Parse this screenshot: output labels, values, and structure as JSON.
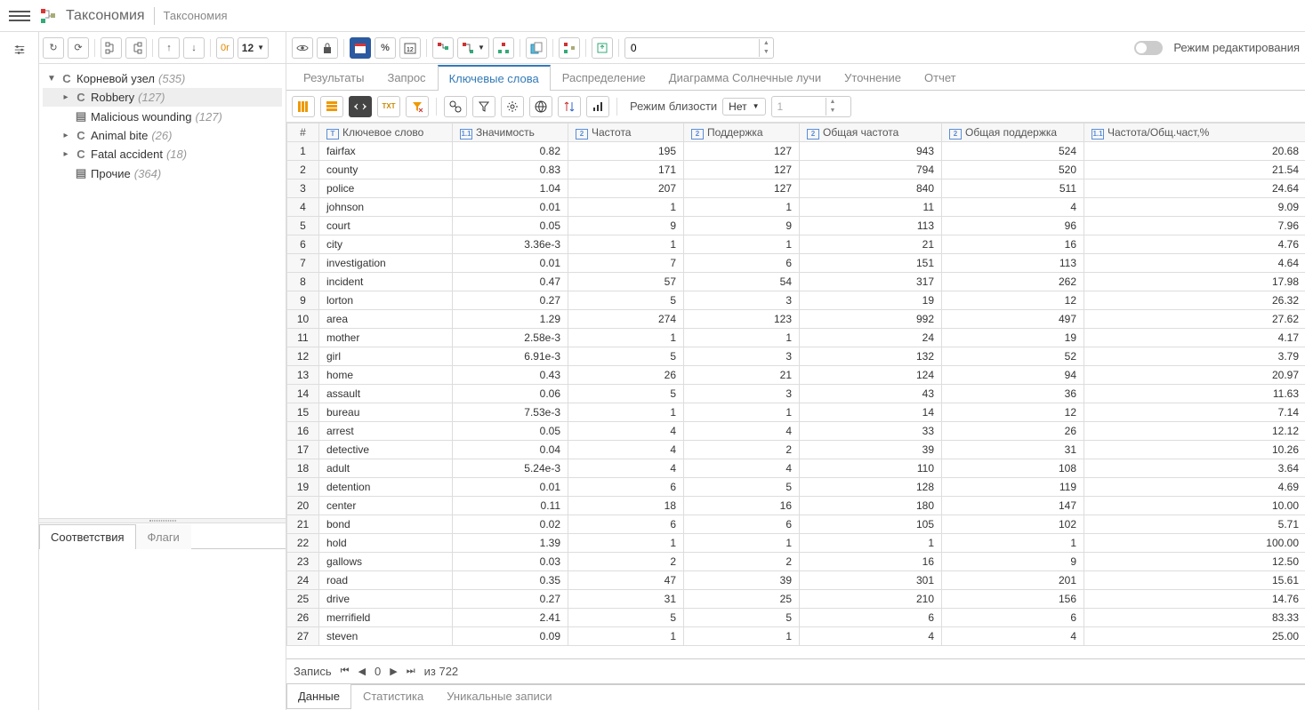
{
  "header": {
    "title": "Таксономия",
    "subtitle": "Таксономия"
  },
  "sidebarToolbar": {
    "or_label": "0r",
    "font_size": "12"
  },
  "tree": {
    "root": {
      "label": "Корневой узел",
      "count": "(535)",
      "type": "C"
    },
    "children": [
      {
        "label": "Robbery",
        "count": "(127)",
        "type": "C",
        "selected": true,
        "expandable": true
      },
      {
        "label": "Malicious wounding",
        "count": "(127)",
        "type": "D",
        "expandable": false
      },
      {
        "label": "Animal bite",
        "count": "(26)",
        "type": "C",
        "expandable": true
      },
      {
        "label": "Fatal accident",
        "count": "(18)",
        "type": "C",
        "expandable": true
      },
      {
        "label": "Прочие",
        "count": "(364)",
        "type": "D",
        "expandable": false
      }
    ]
  },
  "bottomPanelTabs": [
    {
      "label": "Соответствия",
      "active": true
    },
    {
      "label": "Флаги",
      "active": false
    }
  ],
  "mainToolbar": {
    "num_input_value": "0",
    "edit_mode_label": "Режим редактирования"
  },
  "mainTabs": [
    {
      "label": "Результаты",
      "active": false
    },
    {
      "label": "Запрос",
      "active": false
    },
    {
      "label": "Ключевые слова",
      "active": true
    },
    {
      "label": "Распределение",
      "active": false
    },
    {
      "label": "Диаграмма Солнечные лучи",
      "active": false
    },
    {
      "label": "Уточнение",
      "active": false
    },
    {
      "label": "Отчет",
      "active": false
    }
  ],
  "filterBar": {
    "proximity_label": "Режим близости",
    "proximity_value": "Нет",
    "spinner_value": "1"
  },
  "table": {
    "columns": [
      {
        "label": "#",
        "icon": ""
      },
      {
        "label": "Ключевое слово",
        "icon": "T"
      },
      {
        "label": "Значимость",
        "icon": "1.1"
      },
      {
        "label": "Частота",
        "icon": "2"
      },
      {
        "label": "Поддержка",
        "icon": "2"
      },
      {
        "label": "Общая частота",
        "icon": "2"
      },
      {
        "label": "Общая поддержка",
        "icon": "2"
      },
      {
        "label": "Частота/Общ.част,%",
        "icon": "1.1"
      }
    ],
    "rows": [
      [
        "1",
        "fairfax",
        "0.82",
        "195",
        "127",
        "943",
        "524",
        "20.68"
      ],
      [
        "2",
        "county",
        "0.83",
        "171",
        "127",
        "794",
        "520",
        "21.54"
      ],
      [
        "3",
        "police",
        "1.04",
        "207",
        "127",
        "840",
        "511",
        "24.64"
      ],
      [
        "4",
        "johnson",
        "0.01",
        "1",
        "1",
        "11",
        "4",
        "9.09"
      ],
      [
        "5",
        "court",
        "0.05",
        "9",
        "9",
        "113",
        "96",
        "7.96"
      ],
      [
        "6",
        "city",
        "3.36e-3",
        "1",
        "1",
        "21",
        "16",
        "4.76"
      ],
      [
        "7",
        "investigation",
        "0.01",
        "7",
        "6",
        "151",
        "113",
        "4.64"
      ],
      [
        "8",
        "incident",
        "0.47",
        "57",
        "54",
        "317",
        "262",
        "17.98"
      ],
      [
        "9",
        "lorton",
        "0.27",
        "5",
        "3",
        "19",
        "12",
        "26.32"
      ],
      [
        "10",
        "area",
        "1.29",
        "274",
        "123",
        "992",
        "497",
        "27.62"
      ],
      [
        "11",
        "mother",
        "2.58e-3",
        "1",
        "1",
        "24",
        "19",
        "4.17"
      ],
      [
        "12",
        "girl",
        "6.91e-3",
        "5",
        "3",
        "132",
        "52",
        "3.79"
      ],
      [
        "13",
        "home",
        "0.43",
        "26",
        "21",
        "124",
        "94",
        "20.97"
      ],
      [
        "14",
        "assault",
        "0.06",
        "5",
        "3",
        "43",
        "36",
        "11.63"
      ],
      [
        "15",
        "bureau",
        "7.53e-3",
        "1",
        "1",
        "14",
        "12",
        "7.14"
      ],
      [
        "16",
        "arrest",
        "0.05",
        "4",
        "4",
        "33",
        "26",
        "12.12"
      ],
      [
        "17",
        "detective",
        "0.04",
        "4",
        "2",
        "39",
        "31",
        "10.26"
      ],
      [
        "18",
        "adult",
        "5.24e-3",
        "4",
        "4",
        "110",
        "108",
        "3.64"
      ],
      [
        "19",
        "detention",
        "0.01",
        "6",
        "5",
        "128",
        "119",
        "4.69"
      ],
      [
        "20",
        "center",
        "0.11",
        "18",
        "16",
        "180",
        "147",
        "10.00"
      ],
      [
        "21",
        "bond",
        "0.02",
        "6",
        "6",
        "105",
        "102",
        "5.71"
      ],
      [
        "22",
        "hold",
        "1.39",
        "1",
        "1",
        "1",
        "1",
        "100.00"
      ],
      [
        "23",
        "gallows",
        "0.03",
        "2",
        "2",
        "16",
        "9",
        "12.50"
      ],
      [
        "24",
        "road",
        "0.35",
        "47",
        "39",
        "301",
        "201",
        "15.61"
      ],
      [
        "25",
        "drive",
        "0.27",
        "31",
        "25",
        "210",
        "156",
        "14.76"
      ],
      [
        "26",
        "merrifield",
        "2.41",
        "5",
        "5",
        "6",
        "6",
        "83.33"
      ],
      [
        "27",
        "steven",
        "0.09",
        "1",
        "1",
        "4",
        "4",
        "25.00"
      ]
    ]
  },
  "statusBar": {
    "record_label": "Запись",
    "current": "0",
    "of_label": "из 722"
  },
  "bottomTabs": [
    {
      "label": "Данные",
      "active": true
    },
    {
      "label": "Статистика",
      "active": false
    },
    {
      "label": "Уникальные записи",
      "active": false
    }
  ]
}
